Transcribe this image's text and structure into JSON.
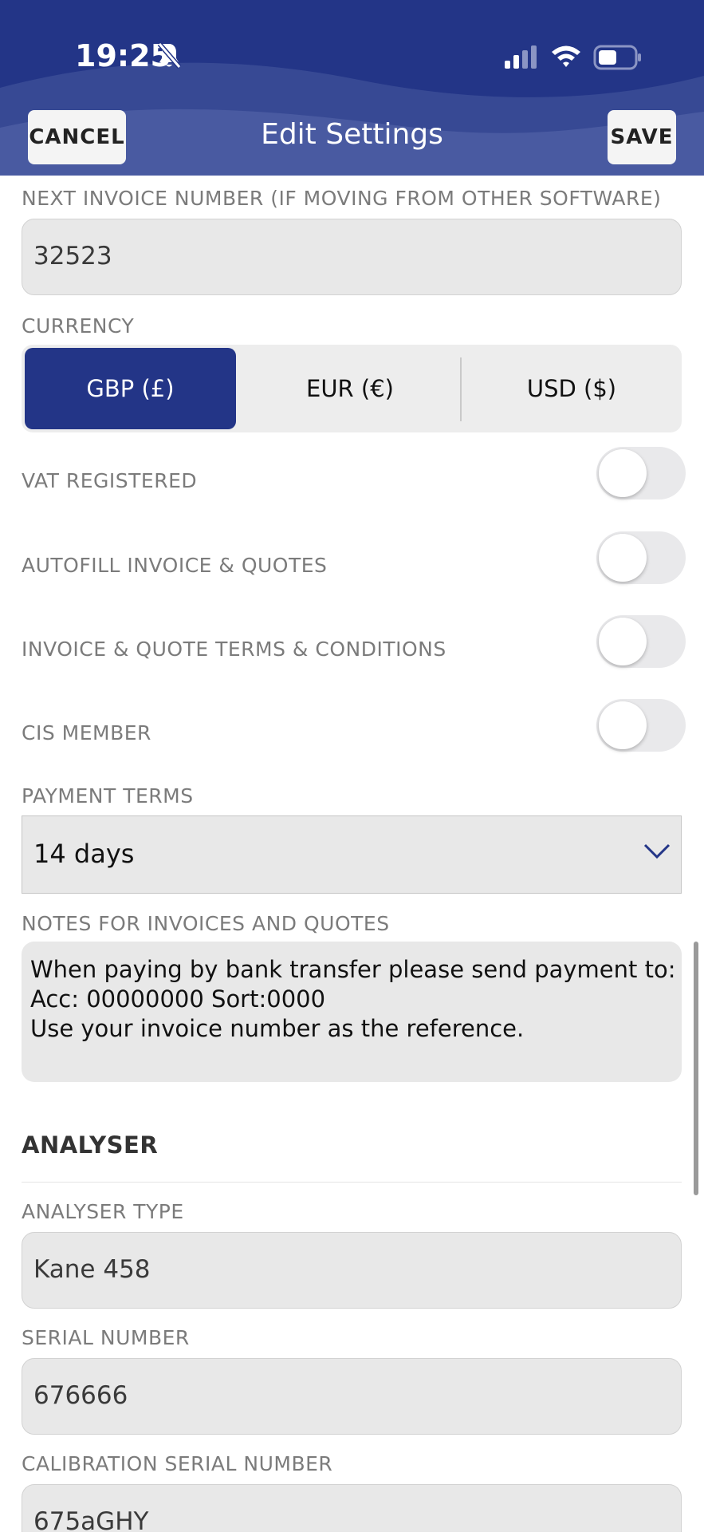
{
  "status_bar": {
    "time": "19:25",
    "icons": [
      "bell-slash-icon",
      "signal-icon",
      "wifi-icon",
      "battery-icon"
    ]
  },
  "header": {
    "title": "Edit Settings",
    "cancel_label": "CANCEL",
    "save_label": "SAVE",
    "background_color": "#233587"
  },
  "form": {
    "next_invoice": {
      "label": "NEXT INVOICE NUMBER (IF MOVING FROM OTHER SOFTWARE)",
      "value": "32523"
    },
    "currency": {
      "label": "CURRENCY",
      "options": [
        "GBP (£)",
        "EUR (€)",
        "USD ($)"
      ],
      "selected": "GBP (£)"
    },
    "toggles": [
      {
        "label": "VAT REGISTERED",
        "on": false
      },
      {
        "label": "AUTOFILL INVOICE & QUOTES",
        "on": false
      },
      {
        "label": "INVOICE & QUOTE TERMS & CONDITIONS",
        "on": false
      },
      {
        "label": "CIS MEMBER",
        "on": false
      }
    ],
    "payment_terms": {
      "label": "PAYMENT TERMS",
      "value": "14 days"
    },
    "notes": {
      "label": "NOTES FOR INVOICES AND QUOTES",
      "lines": [
        "When paying by bank transfer please send payment to:",
        "Acc: 00000000 Sort:0000",
        "Use your invoice number as the reference."
      ]
    }
  },
  "analyser": {
    "heading": "ANALYSER",
    "type": {
      "label": "ANALYSER TYPE",
      "value": "Kane 458"
    },
    "serial": {
      "label": "SERIAL NUMBER",
      "value": "676666"
    },
    "calibration": {
      "label": "CALIBRATION SERIAL NUMBER",
      "value": "675aGHY"
    }
  }
}
